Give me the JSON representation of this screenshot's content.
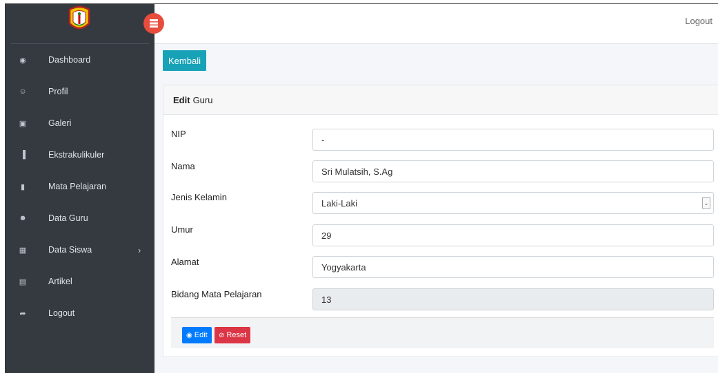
{
  "topbar": {
    "logout_label": "Logout"
  },
  "sidebar": {
    "items": [
      {
        "label": "Dashboard",
        "icon": "dashboard-icon",
        "glyph": "◉"
      },
      {
        "label": "Profil",
        "icon": "user-icon",
        "glyph": "☺"
      },
      {
        "label": "Galeri",
        "icon": "image-icon",
        "glyph": "▣"
      },
      {
        "label": "Ekstrakulikuler",
        "icon": "bar-chart-icon",
        "glyph": "▐"
      },
      {
        "label": "Mata Pelajaran",
        "icon": "book-icon",
        "glyph": "▮"
      },
      {
        "label": "Data Guru",
        "icon": "users-icon",
        "glyph": "☻"
      },
      {
        "label": "Data Siswa",
        "icon": "table-icon",
        "glyph": "▦",
        "arrow": "›"
      },
      {
        "label": "Artikel",
        "icon": "newspaper-icon",
        "glyph": "▤"
      },
      {
        "label": "Logout",
        "icon": "share-icon",
        "glyph": "➦"
      }
    ]
  },
  "main": {
    "back_label": "Kembali",
    "card_title_bold": "Edit",
    "card_title_rest": "Guru",
    "fields": {
      "nip": {
        "label": "NIP",
        "value": "-"
      },
      "nama": {
        "label": "Nama",
        "value": "Sri Mulatsih, S.Ag"
      },
      "jenis_kelamin": {
        "label": "Jenis Kelamin",
        "value": "Laki-Laki"
      },
      "umur": {
        "label": "Umur",
        "value": "29"
      },
      "alamat": {
        "label": "Alamat",
        "value": "Yogyakarta"
      },
      "bidang": {
        "label": "Bidang Mata Pelajaran",
        "value": "13"
      }
    },
    "edit_label": "Edit",
    "reset_label": "Reset"
  },
  "colors": {
    "sidebar_bg": "#343a40",
    "accent_info": "#17a2b8",
    "primary": "#007bff",
    "danger": "#dc3545",
    "toggle": "#e74c3c"
  }
}
